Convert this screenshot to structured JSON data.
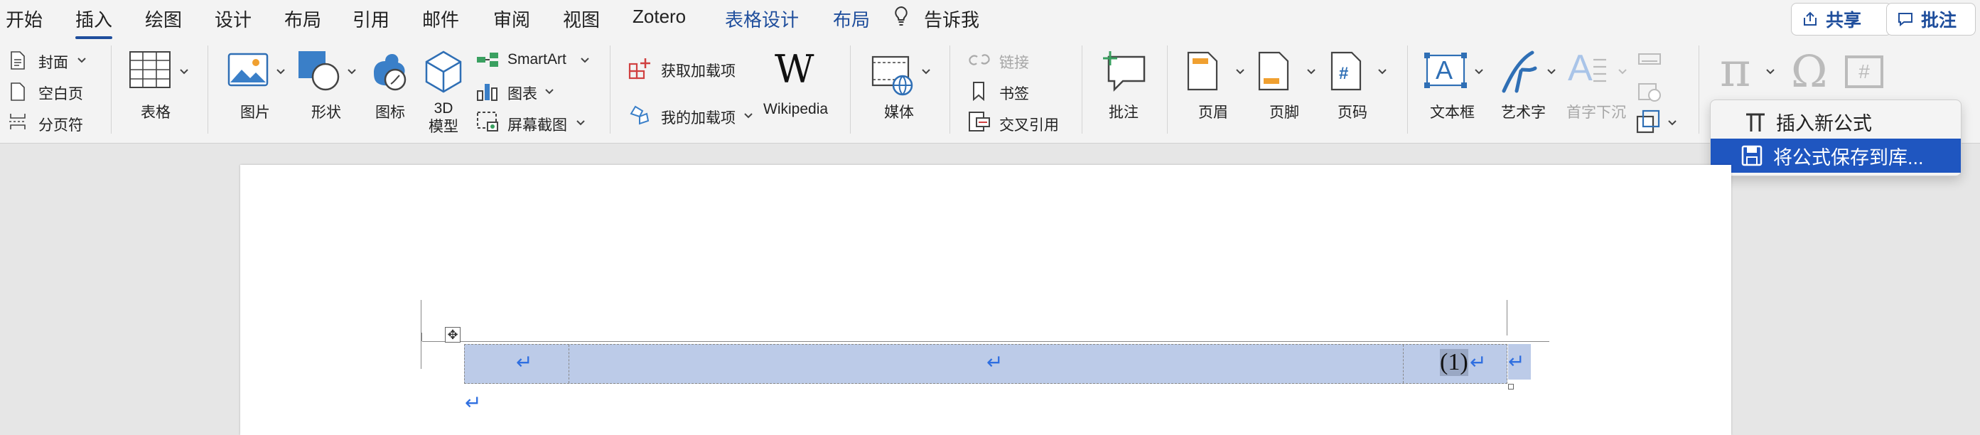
{
  "tabs": [
    {
      "label": "开始"
    },
    {
      "label": "插入"
    },
    {
      "label": "绘图"
    },
    {
      "label": "设计"
    },
    {
      "label": "布局"
    },
    {
      "label": "引用"
    },
    {
      "label": "邮件"
    },
    {
      "label": "审阅"
    },
    {
      "label": "视图"
    },
    {
      "label": "Zotero"
    },
    {
      "label": "表格设计"
    },
    {
      "label": "布局"
    },
    {
      "label": "告诉我"
    }
  ],
  "active_tab": "插入",
  "top_buttons": {
    "share": "共享",
    "comment": "批注"
  },
  "ribbon": {
    "pages": {
      "cover": "封面",
      "blank": "空白页",
      "break": "分页符"
    },
    "table": "表格",
    "picture": "图片",
    "shapes": "形状",
    "icons": "图标",
    "model3d_line1": "3D",
    "model3d_line2": "模型",
    "smartart": "SmartArt",
    "chart": "图表",
    "screenshot": "屏幕截图",
    "get_addins": "获取加载项",
    "my_addins": "我的加载项",
    "wikipedia": "Wikipedia",
    "wiki_logo": "W",
    "media": "媒体",
    "link": "链接",
    "bookmark": "书签",
    "crossref": "交叉引用",
    "comment": "批注",
    "header": "页眉",
    "footer": "页脚",
    "page_number": "页码",
    "page_number_symbol": "#",
    "textbox": "文本框",
    "textbox_symbol": "A",
    "wordart": "艺术字",
    "dropcap": "首字下沉",
    "dropcap_symbol": "A",
    "equation_symbol": "π",
    "symbol_symbol": "Ω",
    "number_symbol": "#"
  },
  "equation_menu": {
    "items": [
      {
        "label": "插入新公式",
        "selected": false
      },
      {
        "label": "将公式保存到库...",
        "selected": true
      }
    ]
  },
  "document": {
    "return_mark": "↵",
    "table_row": {
      "cells": [
        "",
        "",
        "(1)"
      ]
    },
    "move_handle": "✥"
  },
  "colors": {
    "accent": "#1f4e9c",
    "selection": "#1f56c0",
    "table_fill": "#bccbe8"
  }
}
